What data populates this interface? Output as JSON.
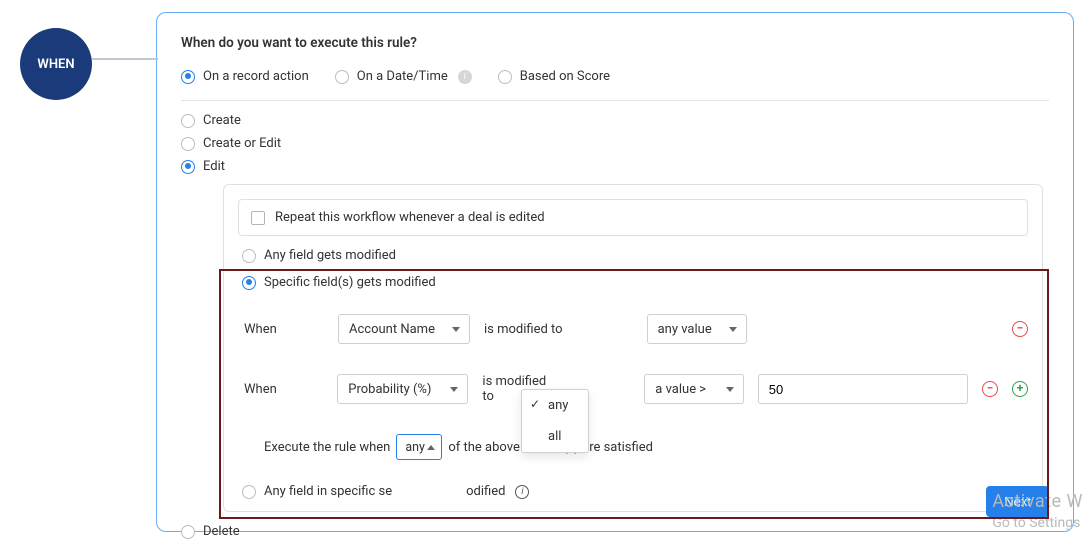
{
  "circle_label": "WHEN",
  "heading": "When do you want to execute this rule?",
  "trigger_options": [
    "On a record action",
    "On a Date/Time",
    "Based on Score"
  ],
  "action_options": [
    "Create",
    "Create or Edit",
    "Edit"
  ],
  "repeat_checkbox_label": "Repeat this workflow whenever a deal is edited",
  "mod_scope": {
    "any": "Any field gets modified",
    "specific": "Specific field(s) gets modified",
    "any_in_section_prefix": "Any field in specific se",
    "any_in_section_suffix": "odified"
  },
  "rows": [
    {
      "label": "When",
      "field": "Account Name",
      "mid": "is modified to",
      "target": "any value",
      "value": ""
    },
    {
      "label": "When",
      "field": "Probability (%)",
      "mid": "is modified to",
      "target": "a value >",
      "value": "50"
    }
  ],
  "exec": {
    "prefix": "Execute the rule when",
    "selected": "any",
    "suffix": "of the above criteria(s) are satisfied",
    "options": [
      "any",
      "all"
    ]
  },
  "delete_label": "Delete",
  "next_label": "Next",
  "watermark_top": "Activate W",
  "watermark_bottom": "Go to Settings"
}
